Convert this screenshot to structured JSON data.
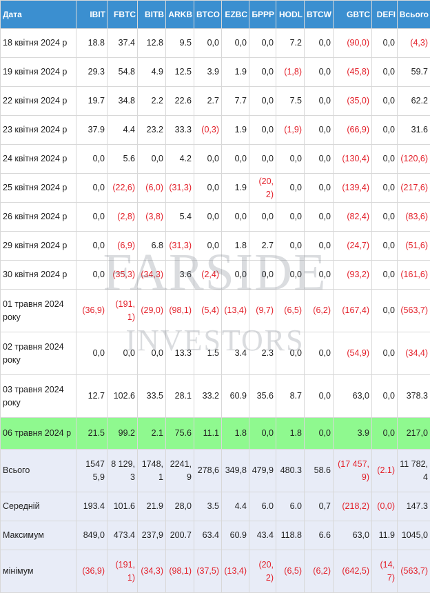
{
  "columns": [
    "Дата",
    "IBIT",
    "FBTC",
    "BITB",
    "ARKB",
    "BTCO",
    "EZBC",
    "БРРР",
    "HODL",
    "BTCW",
    "GBTC",
    "DEFI",
    "Всього"
  ],
  "rows": [
    {
      "style": "",
      "height": 42,
      "cells": [
        "18 квітня 2024 р",
        "18.8",
        "37.4",
        "12.8",
        "9.5",
        "0,0",
        "0,0",
        "0,0",
        "7.2",
        "0,0",
        "(90,0)",
        "0,0",
        "(4,3)"
      ]
    },
    {
      "style": "",
      "height": 42,
      "cells": [
        "19 квітня 2024 р",
        "29.3",
        "54.8",
        "4.9",
        "12.5",
        "3.9",
        "1.9",
        "0,0",
        "(1,8)",
        "0,0",
        "(45,8)",
        "0,0",
        "59.7"
      ]
    },
    {
      "style": "",
      "height": 42,
      "cells": [
        "22 квітня 2024 р",
        "19.7",
        "34.8",
        "2.2",
        "22.6",
        "2.7",
        "7.7",
        "0,0",
        "7.5",
        "0,0",
        "(35,0)",
        "0,0",
        "62.2"
      ]
    },
    {
      "style": "",
      "height": 42,
      "cells": [
        "23 квітня 2024 р",
        "37.9",
        "4.4",
        "23.2",
        "33.3",
        "(0,3)",
        "1.9",
        "0,0",
        "(1,9)",
        "0,0",
        "(66,9)",
        "0,0",
        "31.6"
      ]
    },
    {
      "style": "",
      "height": 42,
      "cells": [
        "24 квітня 2024 р",
        "0,0",
        "5.6",
        "0,0",
        "4.2",
        "0,0",
        "0,0",
        "0,0",
        "0,0",
        "0,0",
        "(130,4)",
        "0,0",
        "(120,6)"
      ]
    },
    {
      "style": "",
      "height": 42,
      "cells": [
        "25 квітня 2024 р",
        "0,0",
        "(22,6)",
        "(6,0)",
        "(31,3)",
        "0,0",
        "1.9",
        "(20,2)",
        "0,0",
        "0,0",
        "(139,4)",
        "0,0",
        "(217,6)"
      ]
    },
    {
      "style": "",
      "height": 42,
      "cells": [
        "26 квітня 2024 р",
        "0,0",
        "(2,8)",
        "(3,8)",
        "5.4",
        "0,0",
        "0,0",
        "0,0",
        "0,0",
        "0,0",
        "(82,4)",
        "0,0",
        "(83,6)"
      ]
    },
    {
      "style": "",
      "height": 42,
      "cells": [
        "29 квітня 2024 р",
        "0,0",
        "(6,9)",
        "6.8",
        "(31,3)",
        "0,0",
        "1.8",
        "2.7",
        "0,0",
        "0,0",
        "(24,7)",
        "0,0",
        "(51,6)"
      ]
    },
    {
      "style": "",
      "height": 42,
      "cells": [
        "30 квітня 2024 р",
        "0,0",
        "(35,3)",
        "(34,3)",
        "3.6",
        "(2,4)",
        "0,0",
        "0,0",
        "0,0",
        "0,0",
        "(93,2)",
        "0,0",
        "(161,6)"
      ]
    },
    {
      "style": "",
      "height": 62,
      "cells": [
        "01 травня 2024 року",
        "(36,9)",
        "(191,1)",
        "(29,0)",
        "(98,1)",
        "(5,4)",
        "(13,4)",
        "(9,7)",
        "(6,5)",
        "(6,2)",
        "(167,4)",
        "0,0",
        "(563,7)"
      ]
    },
    {
      "style": "",
      "height": 62,
      "cells": [
        "02 травня 2024 року",
        "0,0",
        "0,0",
        "0,0",
        "13.3",
        "1.5",
        "3.4",
        "2.3",
        "0,0",
        "0,0",
        "(54,9)",
        "0,0",
        "(34,4)"
      ]
    },
    {
      "style": "",
      "height": 62,
      "cells": [
        "03 травня 2024 року",
        "12.7",
        "102.6",
        "33.5",
        "28.1",
        "33.2",
        "60.9",
        "35.6",
        "8.7",
        "0,0",
        "63,0",
        "0,0",
        "378.3"
      ]
    },
    {
      "style": "row-hl",
      "height": 46,
      "cells": [
        "06 травня 2024 р",
        "21.5",
        "99.2",
        "2.1",
        "75.6",
        "11.1",
        "1.8",
        "0,0",
        "1.8",
        "0,0",
        "3.9",
        "0,0",
        "217,0"
      ]
    },
    {
      "style": "row-stat",
      "height": 62,
      "cells": [
        "Всього",
        "15475,9",
        "8 129,3",
        "1748,1",
        "2241,9",
        "278,6",
        "349,8",
        "479,9",
        "480.3",
        "58.6",
        "(17 457,9)",
        "(2.1)",
        "11 782,4"
      ]
    },
    {
      "style": "row-stat",
      "height": 42,
      "cells": [
        "Середній",
        "193.4",
        "101.6",
        "21.9",
        "28,0",
        "3.5",
        "4.4",
        "6.0",
        "6.0",
        "0,7",
        "(218,2)",
        "(0,0)",
        "147.3"
      ]
    },
    {
      "style": "row-stat",
      "height": 42,
      "cells": [
        "Максимум",
        "849,0",
        "473.4",
        "237,9",
        "200.7",
        "63.4",
        "60.9",
        "43.4",
        "118.8",
        "6.6",
        "63,0",
        "11.9",
        "1045,0"
      ]
    },
    {
      "style": "row-stat",
      "height": 62,
      "cells": [
        "мінімум",
        "(36,9)",
        "(191,1)",
        "(34,3)",
        "(98,1)",
        "(37,5)",
        "(13,4)",
        "(20,2)",
        "(6,5)",
        "(6,2)",
        "(642,5)",
        "(14,7)",
        "(563,7)"
      ]
    }
  ],
  "watermark": {
    "line1": "FARSIDE",
    "line2": "INVESTORS",
    "color": "#6b7280"
  },
  "colors": {
    "header_bg": "#3b8fd0",
    "negative": "#e3202a",
    "highlight_row": "#8ff98f",
    "stat_rows": "#e8ecf7"
  }
}
